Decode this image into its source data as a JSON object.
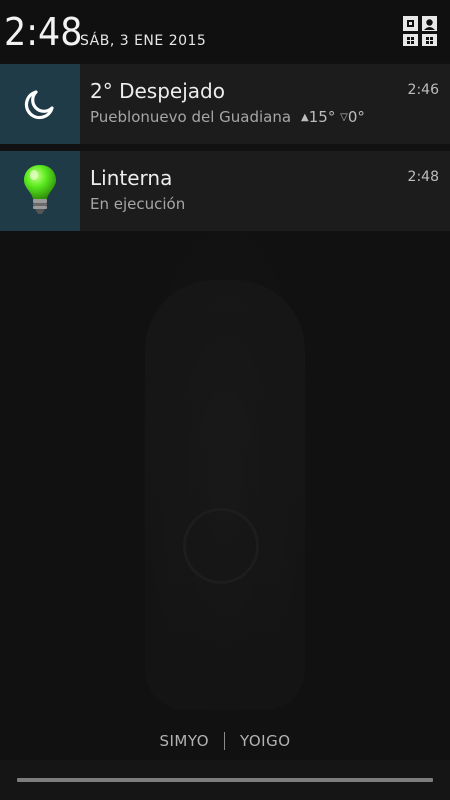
{
  "header": {
    "time": "2:48",
    "date": "SÁB, 3 ENE 2015",
    "quick_settings_icon": "quick-settings-user-icon"
  },
  "notifications": [
    {
      "app_icon": "moon-icon",
      "icon_bg": "#1f3b47",
      "title": "2° Despejado",
      "location": "Pueblonuevo del Guadiana",
      "high_arrow": "▲",
      "high": "15°",
      "low_arrow": "▽",
      "low": "0°",
      "time": "2:46"
    },
    {
      "app_icon": "lightbulb-icon",
      "icon_bg": "#1f3b47",
      "bulb_color": "#5bea1f",
      "title": "Linterna",
      "subtitle": "En ejecución",
      "time": "2:48"
    }
  ],
  "carriers": [
    "SIMYO",
    "YOIGO"
  ]
}
